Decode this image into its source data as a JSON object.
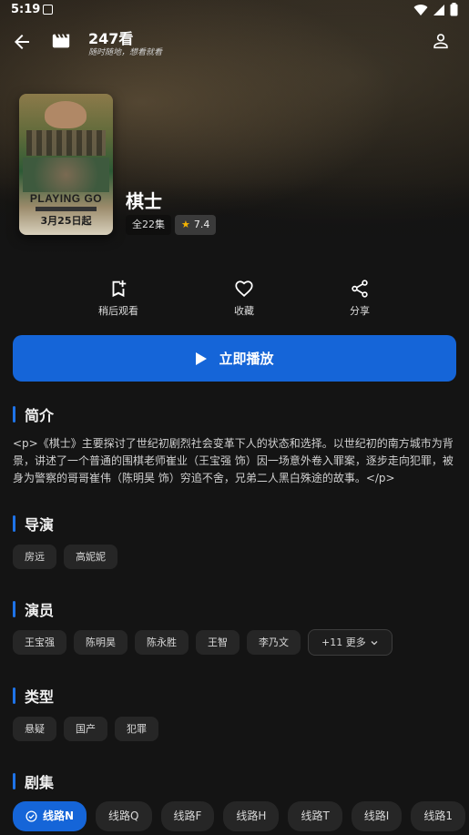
{
  "status": {
    "time": "5:19"
  },
  "app": {
    "title": "247看",
    "subtitle": "随时随地，想看就看"
  },
  "show": {
    "poster_title": "PLAYING GO",
    "poster_date": "3月25日起",
    "title": "棋士",
    "episodes": "全22集",
    "rating": "7.4"
  },
  "actions": {
    "watch_later": "稍后观看",
    "favorite": "收藏",
    "share": "分享"
  },
  "play": {
    "label": "立即播放"
  },
  "sections": {
    "synopsis": "简介",
    "director": "导演",
    "cast": "演员",
    "genre": "类型",
    "episodes": "剧集"
  },
  "synopsis": "<p>《棋士》主要探讨了世纪初剧烈社会变革下人的状态和选择。以世纪初的南方城市为背景，讲述了一个普通的围棋老师崔业（王宝强 饰）因一场意外卷入罪案，逐步走向犯罪，被身为警察的哥哥崔伟（陈明昊 饰）穷追不舍，兄弟二人黑白殊途的故事。</p>",
  "directors": [
    "房远",
    "高妮妮"
  ],
  "cast": [
    "王宝强",
    "陈明昊",
    "陈永胜",
    "王智",
    "李乃文"
  ],
  "cast_more": "+11 更多",
  "genres": [
    "悬疑",
    "国产",
    "犯罪"
  ],
  "lines": [
    "线路N",
    "线路Q",
    "线路F",
    "线路H",
    "线路T",
    "线路I",
    "线路1"
  ],
  "colors": {
    "accent": "#1565d8",
    "background": "#141414",
    "star": "#f5b400"
  }
}
